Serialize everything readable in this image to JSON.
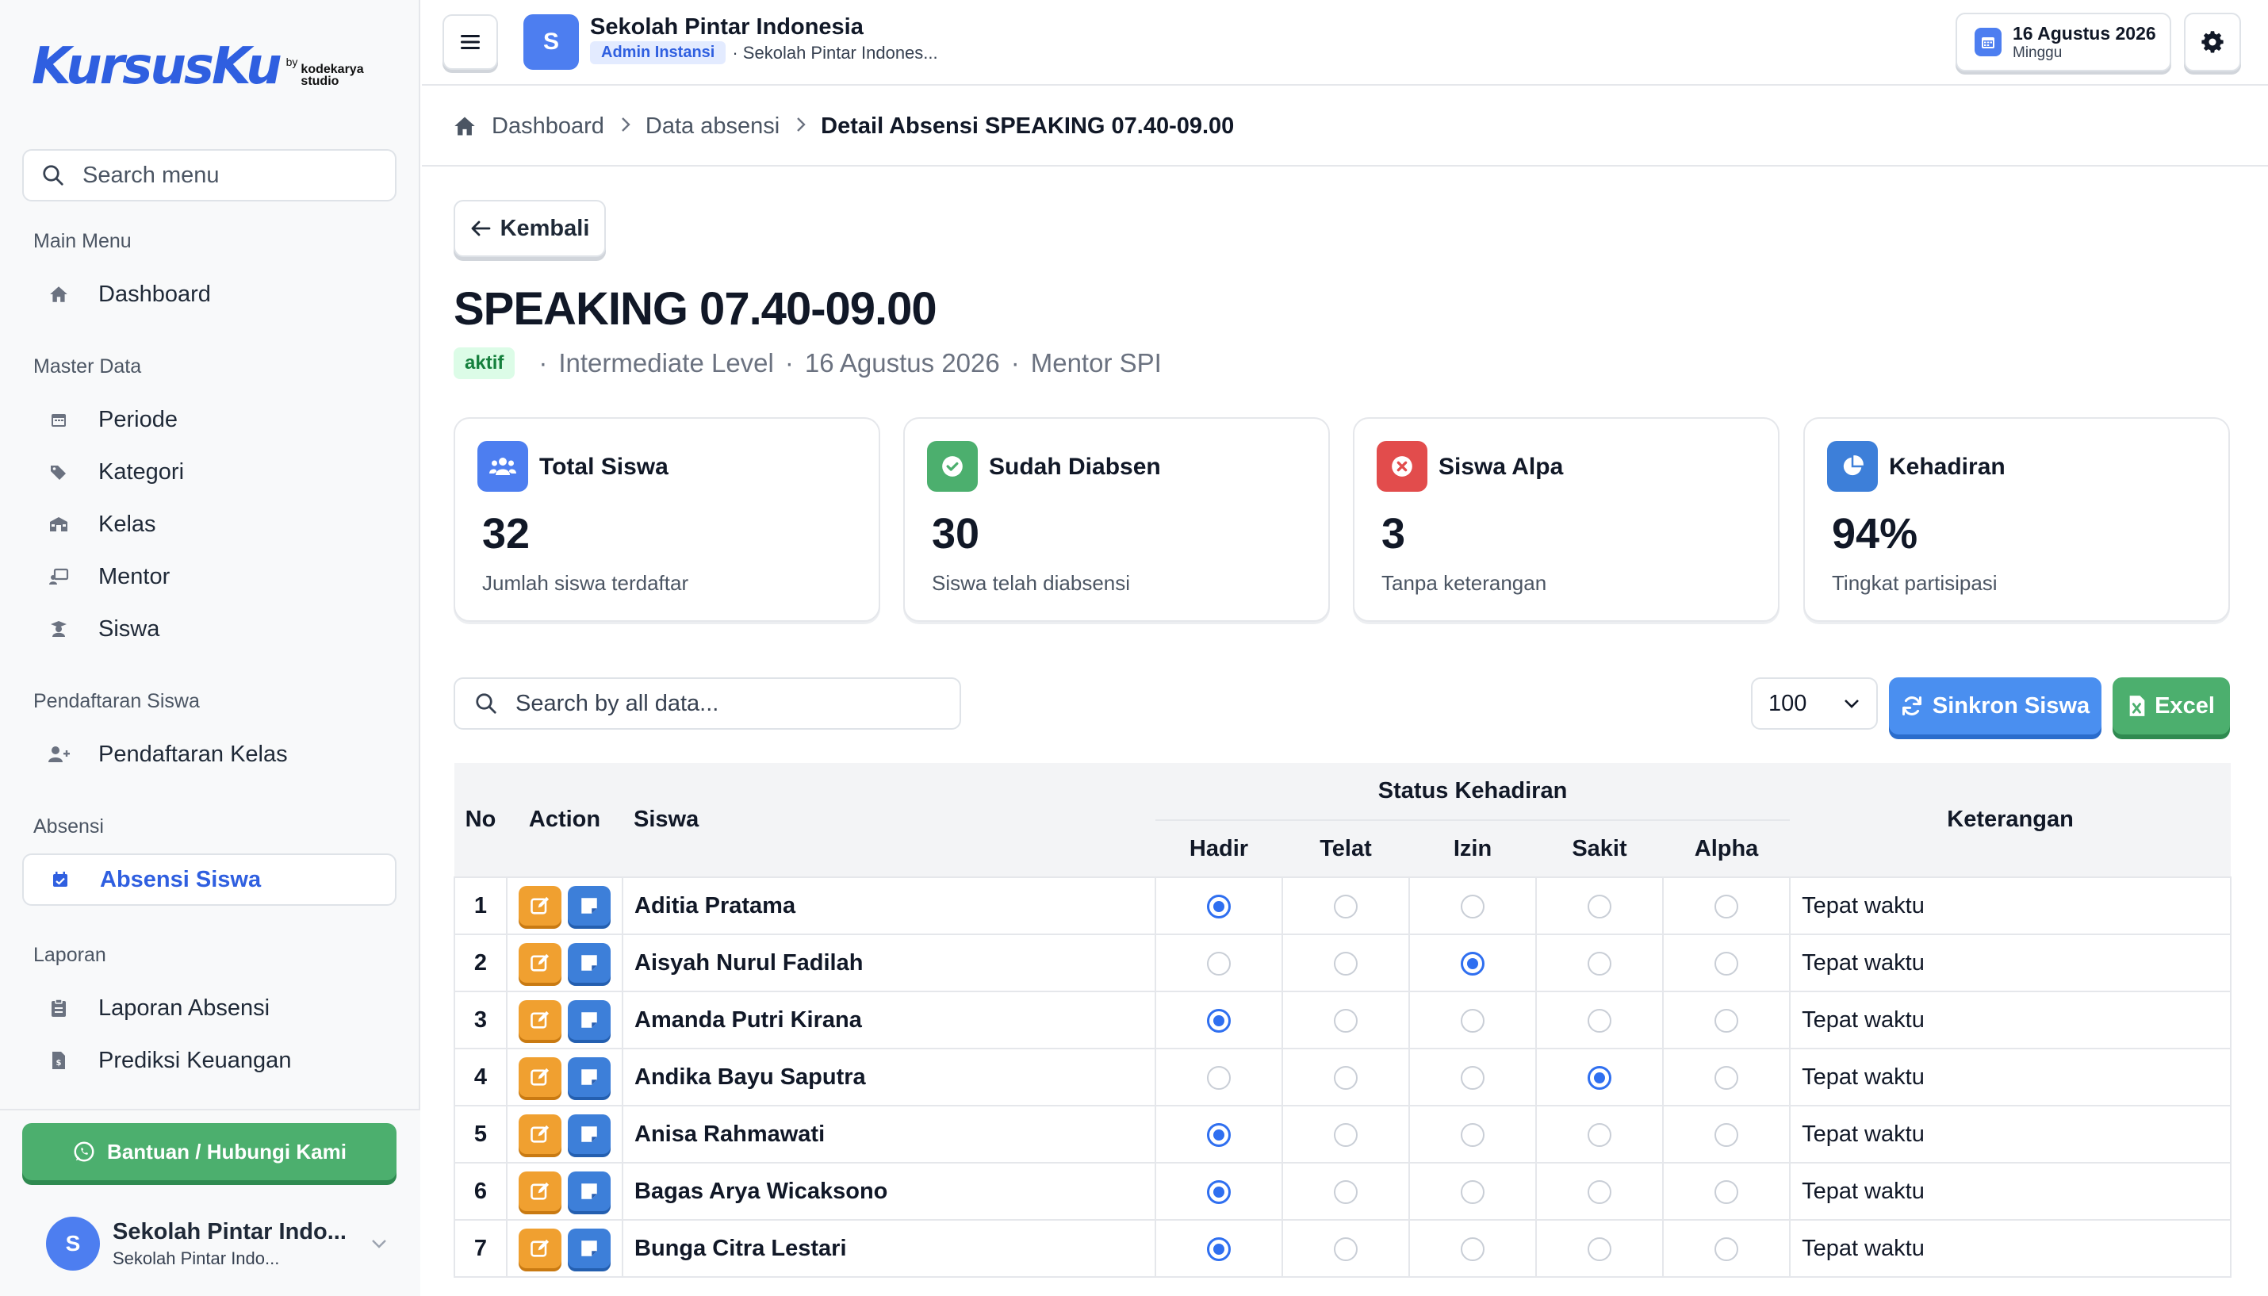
{
  "brand": {
    "name": "KursusKu",
    "by": "by",
    "studio": "kodekarya studio"
  },
  "sidebar": {
    "search_placeholder": "Search menu",
    "sections": {
      "main": "Main Menu",
      "master": "Master Data",
      "pendaftaran": "Pendaftaran Siswa",
      "absensi": "Absensi",
      "laporan": "Laporan"
    },
    "items": {
      "dashboard": "Dashboard",
      "periode": "Periode",
      "kategori": "Kategori",
      "kelas": "Kelas",
      "mentor": "Mentor",
      "siswa": "Siswa",
      "pendaftaran_kelas": "Pendaftaran Kelas",
      "absensi_siswa": "Absensi Siswa",
      "laporan_absensi": "Laporan Absensi",
      "prediksi_keuangan": "Prediksi Keuangan"
    },
    "help_label": "Bantuan / Hubungi Kami",
    "user": {
      "initial": "S",
      "name": "Sekolah Pintar Indo...",
      "sub": "Sekolah Pintar Indo..."
    }
  },
  "topbar": {
    "org_initial": "S",
    "org_name": "Sekolah Pintar Indonesia",
    "role": "Admin Instansi",
    "org_sub": "· Sekolah Pintar Indones...",
    "date": "16 Agustus 2026",
    "day": "Minggu"
  },
  "breadcrumb": {
    "home": "Dashboard",
    "parent": "Data absensi",
    "current": "Detail Absensi SPEAKING 07.40-09.00"
  },
  "page": {
    "back_label": "Kembali",
    "title": "SPEAKING 07.40-09.00",
    "status": "aktif",
    "level": "Intermediate Level",
    "date": "16 Agustus 2026",
    "mentor": "Mentor SPI",
    "separator": "·"
  },
  "stats": {
    "total": {
      "label": "Total Siswa",
      "value": "32",
      "desc": "Jumlah siswa terdaftar",
      "color": "#4d7ef0"
    },
    "done": {
      "label": "Sudah Diabsen",
      "value": "30",
      "desc": "Siswa telah diabsensi",
      "color": "#4caf6e"
    },
    "alpa": {
      "label": "Siswa Alpa",
      "value": "3",
      "desc": "Tanpa keterangan",
      "color": "#e24c4c"
    },
    "rate": {
      "label": "Kehadiran",
      "value": "94%",
      "desc": "Tingkat partisipasi",
      "color": "#3d7fd9"
    }
  },
  "toolbar": {
    "search_placeholder": "Search by all data...",
    "per_page": "100",
    "sync_label": "Sinkron Siswa",
    "excel_label": "Excel"
  },
  "table": {
    "headers": {
      "no": "No",
      "action": "Action",
      "siswa": "Siswa",
      "status_group": "Status Kehadiran",
      "hadir": "Hadir",
      "telat": "Telat",
      "izin": "Izin",
      "sakit": "Sakit",
      "alpha": "Alpha",
      "keterangan": "Keterangan"
    },
    "rows": [
      {
        "no": "1",
        "name": "Aditia Pratama",
        "status": "hadir",
        "ket": "Tepat waktu"
      },
      {
        "no": "2",
        "name": "Aisyah Nurul Fadilah",
        "status": "izin",
        "ket": "Tepat waktu"
      },
      {
        "no": "3",
        "name": "Amanda Putri Kirana",
        "status": "hadir",
        "ket": "Tepat waktu"
      },
      {
        "no": "4",
        "name": "Andika Bayu Saputra",
        "status": "sakit",
        "ket": "Tepat waktu"
      },
      {
        "no": "5",
        "name": "Anisa Rahmawati",
        "status": "hadir",
        "ket": "Tepat waktu"
      },
      {
        "no": "6",
        "name": "Bagas Arya Wicaksono",
        "status": "hadir",
        "ket": "Tepat waktu"
      },
      {
        "no": "7",
        "name": "Bunga Citra Lestari",
        "status": "hadir",
        "ket": "Tepat waktu"
      }
    ]
  }
}
